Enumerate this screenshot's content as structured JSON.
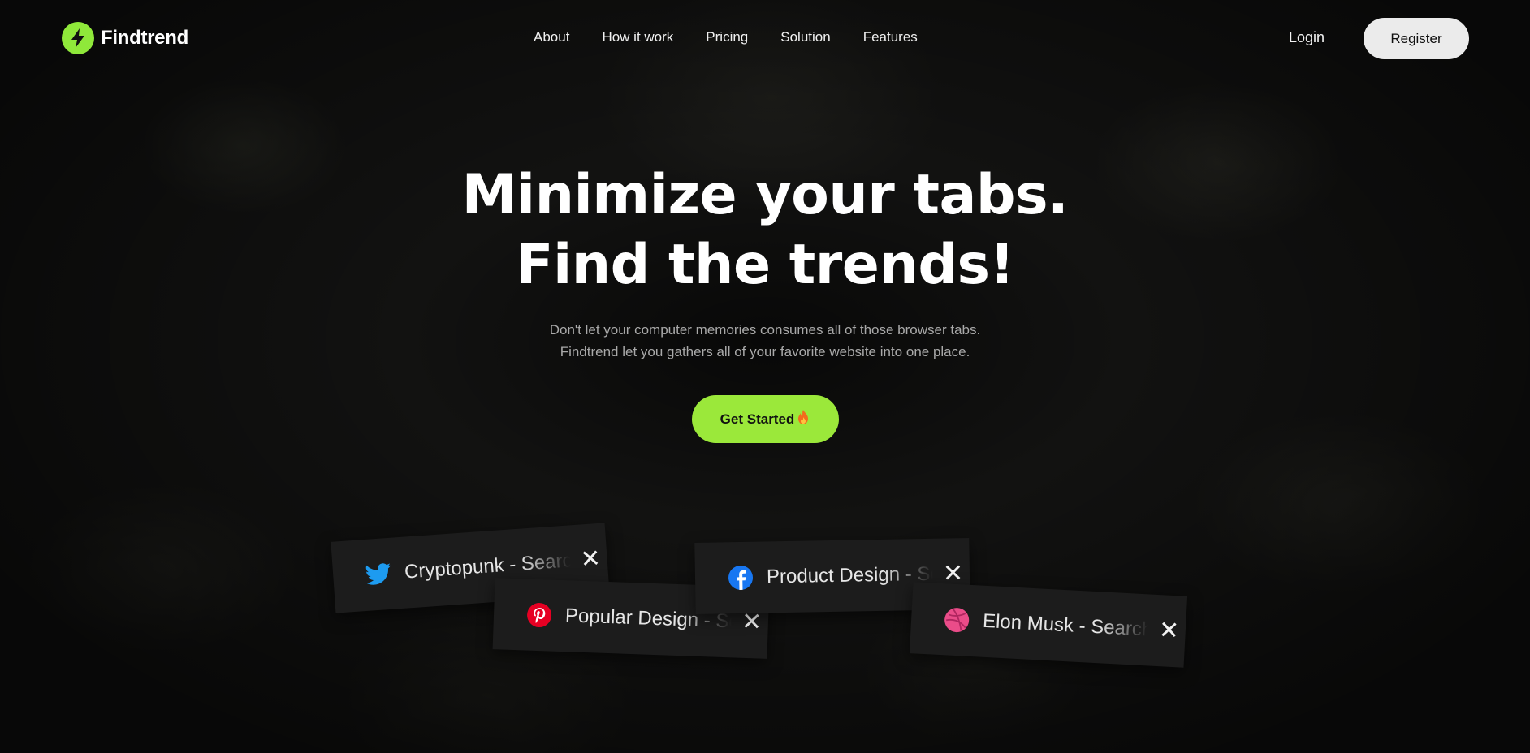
{
  "brand": {
    "name": "Findtrend",
    "accent": "#9be83a"
  },
  "nav": {
    "links": [
      "About",
      "How it work",
      "Pricing",
      "Solution",
      "Features"
    ],
    "login": "Login",
    "register": "Register"
  },
  "hero": {
    "title_line1": "Minimize your tabs.",
    "title_line2": "Find the trends!",
    "sub_line1": "Don't let your computer memories consumes all of those browser tabs.",
    "sub_line2": "Findtrend let you gathers all of your favorite website into one place.",
    "cta": "Get Started"
  },
  "tabs": [
    {
      "icon": "twitter-icon",
      "title": "Cryptopunk - Search",
      "close": "✕"
    },
    {
      "icon": "pinterest-icon",
      "title": "Popular Design - Search",
      "close": "✕"
    },
    {
      "icon": "facebook-icon",
      "title": "Product Design - Search",
      "close": "✕"
    },
    {
      "icon": "dribbble-icon",
      "title": "Elon Musk - Search",
      "close": "✕"
    }
  ]
}
